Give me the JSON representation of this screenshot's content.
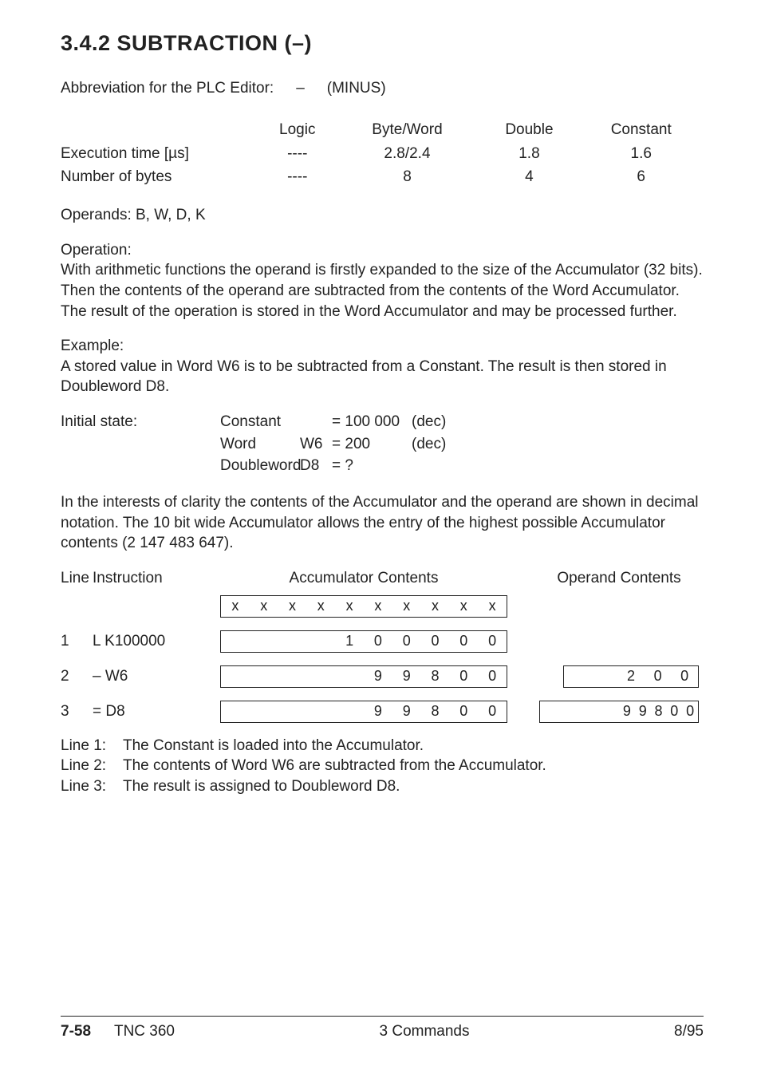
{
  "heading": "3.4.2  SUBTRACTION   (–)",
  "abbr": {
    "label": "Abbreviation for the PLC Editor:",
    "symbol": "–",
    "name": "(MINUS)"
  },
  "timing": {
    "cols": [
      "Logic",
      "Byte/Word",
      "Double",
      "Constant"
    ],
    "rows": [
      {
        "label": "Execution time [µs]",
        "vals": [
          "----",
          "2.8/2.4",
          "1.8",
          "1.6"
        ]
      },
      {
        "label": "Number of bytes",
        "vals": [
          "----",
          "8",
          "4",
          "6"
        ]
      }
    ]
  },
  "operands": "Operands: B, W, D, K",
  "operation": {
    "label": "Operation:",
    "text": "With arithmetic functions the operand is firstly expanded to the size of the Accumulator (32 bits). Then the contents of the operand are subtracted from the contents of the Word Accumulator. The result of the operation is stored in the Word Accumulator and may be processed further."
  },
  "example": {
    "label": "Example:",
    "text": "A stored value in Word W6 is to be subtracted from a Constant. The result is then stored in Doubleword D8."
  },
  "initial": {
    "label": "Initial state:",
    "rows": [
      {
        "c1": "Constant",
        "c2": "",
        "c3": "= 100 000",
        "c4": "(dec)"
      },
      {
        "c1": "Word",
        "c2": "W6",
        "c3": "= 200",
        "c4": "(dec)"
      },
      {
        "c1": "Doubleword",
        "c2": "D8",
        "c3": "= ?",
        "c4": ""
      }
    ]
  },
  "clarity": "In the interests of clarity the contents of the Accumulator and the operand are shown in decimal notation.  The 10 bit wide Accumulator allows the entry of the highest possible Accumulator contents (2 147 483 647).",
  "trace": {
    "headers": {
      "line": "Line",
      "instr": "Instruction",
      "acc": "Accumulator Contents",
      "op": "Operand Contents"
    },
    "rows": [
      {
        "line": "",
        "instr": "",
        "acc": [
          "x",
          "x",
          "x",
          "x",
          "x",
          "x",
          "x",
          "x",
          "x",
          "x"
        ],
        "op": null
      },
      {
        "line": "1",
        "instr": "L K100000",
        "acc": [
          "",
          "",
          "",
          "",
          "1",
          "0",
          "0",
          "0",
          "0",
          "0"
        ],
        "op": null
      },
      {
        "line": "2",
        "instr": "–  W6",
        "acc": [
          "",
          "",
          "",
          "",
          "",
          "9",
          "9",
          "8",
          "0",
          "0"
        ],
        "op": {
          "type": "w",
          "digits": [
            "",
            "",
            "2",
            "0",
            "0"
          ]
        }
      },
      {
        "line": "3",
        "instr": "=  D8",
        "acc": [
          "",
          "",
          "",
          "",
          "",
          "9",
          "9",
          "8",
          "0",
          "0"
        ],
        "op": {
          "type": "d",
          "digits": [
            "",
            "",
            "",
            "",
            "",
            "9",
            "9",
            "8",
            "0",
            "0"
          ]
        }
      }
    ]
  },
  "explanations": [
    {
      "k": "Line 1:",
      "v": "The Constant is loaded into the Accumulator."
    },
    {
      "k": "Line 2:",
      "v": "The contents of Word W6 are subtracted from the Accumulator."
    },
    {
      "k": "Line 3:",
      "v": "The result is assigned to Doubleword D8."
    }
  ],
  "footer": {
    "page": "7-58",
    "model": "TNC 360",
    "section": "3  Commands",
    "date": "8/95"
  }
}
